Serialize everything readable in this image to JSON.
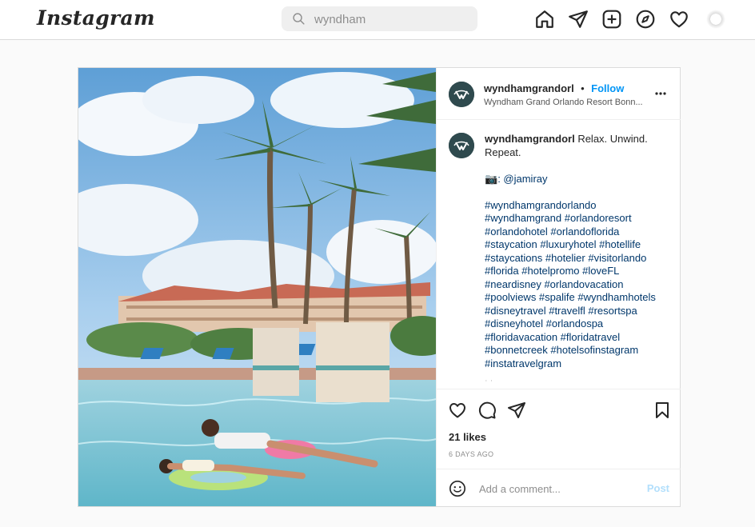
{
  "app": {
    "logo": "Instagram"
  },
  "search": {
    "value": "wyndham"
  },
  "nav": [
    "home-icon",
    "direct-icon",
    "new-post-icon",
    "explore-icon",
    "activity-icon",
    "profile-avatar"
  ],
  "post": {
    "username": "wyndhamgrandorl",
    "follow_label": "Follow",
    "separator": "•",
    "location": "Wyndham Grand Orlando Resort Bonn...",
    "caption": {
      "username": "wyndhamgrandorl",
      "line1": "Relax. Unwind.",
      "line2": "Repeat.",
      "credit_emoji": "📷",
      "credit": ": @jamiray",
      "hashtags": [
        "#wyndhamgrandorlando",
        "#wyndhamgrand #orlandoresort",
        "#orlandohotel #orlandoflorida",
        "#staycation #luxuryhotel #hotellife",
        "#staycations #hotelier #visitorlando",
        "#florida #hotelpromo #loveFL",
        "#neardisney #orlandovacation",
        "#poolviews #spalife #wyndhamhotels",
        "#disneytravel #travelfl #resortspa",
        "#disneyhotel #orlandospa",
        "#floridavacation #floridatravel",
        "#bonnetcreek #hotelsofinstagram",
        "#instatravelgram"
      ],
      "truncated_row": "ʿ ʾ"
    },
    "likes": "21 likes",
    "time_ago": "6 DAYS AGO",
    "comment_placeholder": "Add a comment...",
    "post_label": "Post"
  },
  "colors": {
    "accent": "#0095f6",
    "post_disabled": "#b2dffc",
    "hashtag": "#00376b",
    "brand_avatar": "#2f4a4e"
  }
}
